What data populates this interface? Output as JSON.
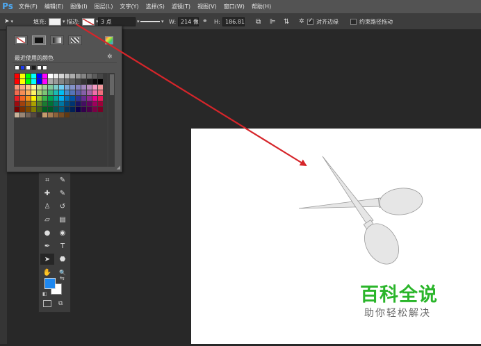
{
  "app": {
    "logo": "Ps"
  },
  "menu": [
    "文件(F)",
    "编辑(E)",
    "图像(I)",
    "图层(L)",
    "文字(Y)",
    "选择(S)",
    "滤镜(T)",
    "视图(V)",
    "窗口(W)",
    "帮助(H)"
  ],
  "options": {
    "fill_label": "填充:",
    "stroke_label": "描边:",
    "stroke_width": "3 点",
    "w_label": "W:",
    "w_value": "214 像",
    "h_label": "H:",
    "h_value": "186.81",
    "align_edges": "对齐边缘",
    "constrain_path": "约束路径拖动"
  },
  "popup": {
    "recent_label": "最近使用的颜色",
    "recent_colors": [
      "#ffffff",
      "#1e3cf0",
      "#ffffff",
      "#1a1a1a",
      "#ffffff",
      "#ffffff"
    ],
    "grid_rows": [
      [
        "#ff0000",
        "#ffff00",
        "#00ff00",
        "#00ffff",
        "#0000ff",
        "#ff00ff",
        "#ffffff",
        "#ebebeb",
        "#d6d6d6",
        "#c2c2c2",
        "#adadad",
        "#999999",
        "#858585",
        "#707070",
        "#5c5c5c",
        "#474747"
      ],
      [
        "#ff0000",
        "#ffff00",
        "#00ff00",
        "#00ffff",
        "#0000ff",
        "#ff00ff",
        "#ababab",
        "#999999",
        "#858585",
        "#707070",
        "#5c5c5c",
        "#474747",
        "#333333",
        "#1f1f1f",
        "#0a0a0a",
        "#000000"
      ],
      [
        "#f7977a",
        "#f9ad81",
        "#fdc68a",
        "#fff79a",
        "#c4df9b",
        "#a3d39c",
        "#82ca9d",
        "#7bcdc8",
        "#6ecff6",
        "#7ea7d8",
        "#8493ca",
        "#8882be",
        "#a187be",
        "#bc8dbf",
        "#f49ac2",
        "#f6989d"
      ],
      [
        "#f26c4f",
        "#f68e55",
        "#fbaf5c",
        "#fff467",
        "#acd372",
        "#7cc576",
        "#3bb878",
        "#1abbb4",
        "#00bff3",
        "#438ccb",
        "#5574b9",
        "#605ca8",
        "#855fa8",
        "#a763a8",
        "#f06ea9",
        "#f26d7d"
      ],
      [
        "#ed1c24",
        "#f26522",
        "#f7941d",
        "#fff200",
        "#8dc73f",
        "#39b54a",
        "#00a651",
        "#00a99d",
        "#00aeef",
        "#0072bc",
        "#0054a5",
        "#2e3192",
        "#662d91",
        "#92278f",
        "#ec008c",
        "#ed145b"
      ],
      [
        "#9e0b0f",
        "#a0410d",
        "#a36209",
        "#aba000",
        "#598527",
        "#1a7b30",
        "#007236",
        "#00746b",
        "#0076a3",
        "#004b80",
        "#003471",
        "#1b1464",
        "#440e62",
        "#630460",
        "#9e005d",
        "#9e0039"
      ],
      [
        "#790000",
        "#7b2e00",
        "#7d4900",
        "#827b00",
        "#406618",
        "#005e20",
        "#005826",
        "#005952",
        "#005b7f",
        "#003663",
        "#002157",
        "#0d004c",
        "#32004b",
        "#4b0049",
        "#7b0046",
        "#7a0026"
      ],
      [
        "#c7b299",
        "#998675",
        "#736357",
        "#534741",
        "#37302d",
        "#c69c6d",
        "#a67c52",
        "#8c6239",
        "#754c24",
        "#603913",
        "#3c3c3c",
        "#3c3c3c",
        "#3c3c3c",
        "#3c3c3c",
        "#3c3c3c",
        "#3c3c3c"
      ]
    ]
  },
  "tools": [
    {
      "name": "crop-tool-icon",
      "glyph": "⌗"
    },
    {
      "name": "eyedropper-tool-icon",
      "glyph": "✎"
    },
    {
      "name": "healing-brush-tool-icon",
      "glyph": "✚"
    },
    {
      "name": "brush-tool-icon",
      "glyph": "✎"
    },
    {
      "name": "clone-stamp-tool-icon",
      "glyph": "♙"
    },
    {
      "name": "history-brush-tool-icon",
      "glyph": "↺"
    },
    {
      "name": "eraser-tool-icon",
      "glyph": "▱"
    },
    {
      "name": "gradient-tool-icon",
      "glyph": "▤"
    },
    {
      "name": "blur-tool-icon",
      "glyph": "●"
    },
    {
      "name": "dodge-tool-icon",
      "glyph": "◉"
    },
    {
      "name": "pen-tool-icon",
      "glyph": "✒"
    },
    {
      "name": "type-tool-icon",
      "glyph": "T"
    },
    {
      "name": "path-selection-tool-icon",
      "glyph": "➤"
    },
    {
      "name": "shape-tool-icon",
      "glyph": "⬣"
    },
    {
      "name": "hand-tool-icon",
      "glyph": "✋"
    },
    {
      "name": "zoom-tool-icon",
      "glyph": "🔍"
    }
  ],
  "colors": {
    "foreground": "#1e88f0",
    "background": "#ffffff",
    "arrow": "#d6252a"
  },
  "watermark": {
    "title": "百科全说",
    "subtitle": "助你轻松解决"
  }
}
